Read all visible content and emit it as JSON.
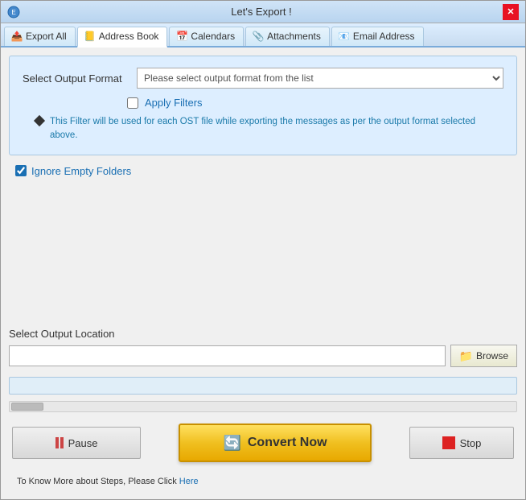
{
  "window": {
    "title": "Let's Export !"
  },
  "tabs": [
    {
      "id": "export-all",
      "label": "Export All",
      "icon": "📤",
      "active": false
    },
    {
      "id": "address-book",
      "label": "Address Book",
      "icon": "📒",
      "active": true
    },
    {
      "id": "calendars",
      "label": "Calendars",
      "icon": "📅",
      "active": false
    },
    {
      "id": "attachments",
      "label": "Attachments",
      "icon": "📎",
      "active": false
    },
    {
      "id": "email-address",
      "label": "Email Address",
      "icon": "📧",
      "active": false
    }
  ],
  "format_section": {
    "label": "Select Output Format",
    "dropdown_placeholder": "Please select output format from the list",
    "filter_label": "Apply Filters",
    "filter_info": "This Filter will be used for each OST file while exporting the messages as per the output format selected above."
  },
  "ignore_empty_folders": {
    "label": "Ignore Empty Folders",
    "checked": true
  },
  "output_location": {
    "label": "Select Output Location",
    "placeholder": "",
    "browse_label": "Browse"
  },
  "actions": {
    "pause_label": "Pause",
    "convert_label": "Convert Now",
    "stop_label": "Stop"
  },
  "footer": {
    "text": "To Know More about Steps, Please Click ",
    "link_text": "Here"
  },
  "close_label": "✕"
}
